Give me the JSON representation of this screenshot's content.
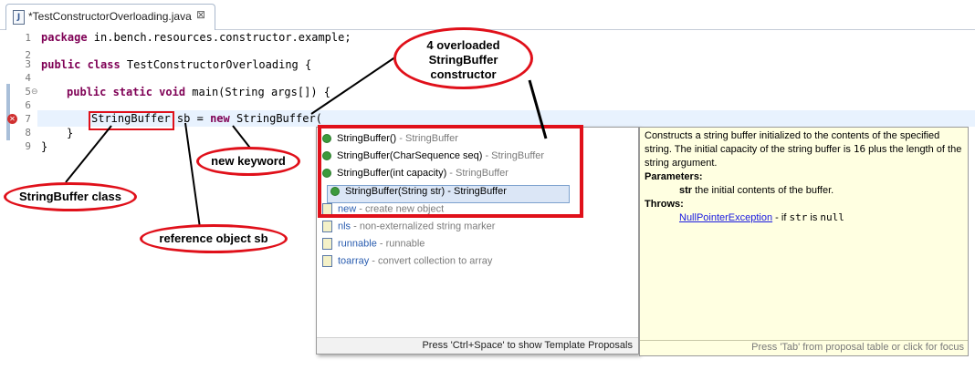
{
  "editor": {
    "tab_title": "*TestConstructorOverloading.java",
    "tab_close": "⊠",
    "file_icon": "J",
    "line_numbers": [
      "1",
      "2",
      "3",
      "4",
      "5",
      "6",
      "7",
      "8",
      "9"
    ],
    "lines": {
      "l1_kw": "package",
      "l1_rest": " in.bench.resources.constructor.example;",
      "l3_kw": "public class",
      "l3_rest": " TestConstructorOverloading {",
      "l5_kw": "public static void",
      "l5_rest": " main(String args[]) {",
      "l7_class": "StringBuffer",
      "l7_mid": " sb = ",
      "l7_kw": "new",
      "l7_rest": " StringBuffer(",
      "l8": "}",
      "l9": "}"
    }
  },
  "proposals": {
    "items": [
      {
        "name": "StringBuffer()",
        "detail": " - StringBuffer",
        "icon": "green-circle-icon"
      },
      {
        "name": "StringBuffer(CharSequence seq)",
        "detail": " - StringBuffer",
        "icon": "green-circle-icon"
      },
      {
        "name": "StringBuffer(int capacity)",
        "detail": " - StringBuffer",
        "icon": "green-circle-icon"
      },
      {
        "name": "StringBuffer(String str) - StringBuffer",
        "detail": "",
        "icon": "green-circle-icon",
        "selected": true
      },
      {
        "name": "new",
        "detail": " - create new object",
        "icon": "template-icon"
      },
      {
        "name": "nls",
        "detail": " - non-externalized string marker",
        "icon": "template-icon"
      },
      {
        "name": "runnable",
        "detail": " - runnable",
        "icon": "template-icon"
      },
      {
        "name": "toarray",
        "detail": " - convert collection to array",
        "icon": "template-icon"
      }
    ],
    "footer": "Press 'Ctrl+Space' to show Template Proposals"
  },
  "javadoc": {
    "desc_a": "Constructs a string buffer initialized to the contents of the specified string. The initial capacity of the string buffer is ",
    "desc_num": "16",
    "desc_b": " plus the length of the string argument.",
    "params_heading": "Parameters:",
    "param_name": "str",
    "param_desc": " the initial contents of the buffer.",
    "throws_heading": "Throws:",
    "throws_link": "NullPointerException",
    "throws_a": " - if ",
    "throws_code1": "str",
    "throws_b": " is ",
    "throws_code2": "null",
    "footer": "Press 'Tab' from proposal table or click for focus"
  },
  "annotations": {
    "overloaded": "4 overloaded StringBuffer constructor",
    "new_keyword": "new keyword",
    "class_label": "StringBuffer class",
    "reference_label": "reference object sb"
  },
  "colors": {
    "annotation_red": "#e0101a",
    "keyword": "#7f0055",
    "doc_bg": "#ffffe1"
  }
}
